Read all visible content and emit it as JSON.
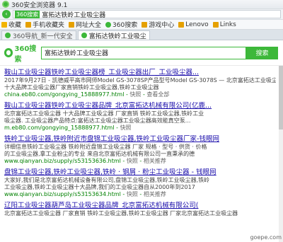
{
  "window": {
    "title": "360安全浏览器 9.1"
  },
  "address": {
    "engine_tag": "360搜索",
    "query": "富拓达铁岭工业吸尘器"
  },
  "bookmarks": [
    "收藏",
    "手机收藏夹",
    "网址大全",
    "360搜索",
    "游戏中心",
    "Lenovo",
    "Links"
  ],
  "tabs": [
    "360导航_新一代安全",
    "富拓达铁岭工业吸尘"
  ],
  "search": {
    "logo": "360搜索",
    "query": "富拓达铁岭工业吸尘器",
    "button": "搜索"
  },
  "results": [
    {
      "title": "鞍山工业吸尘器铁岭工业吸尘器榜_工业吸尘器出厂_工业吸尘器...",
      "desc1": "2017年9月27日 - 凯德威平高市网师Model GS-3078SP产品型号Model GS-3078S — 北京富拓达工业吸尘器",
      "desc2": "十大品牌工业吸尘器厂家直销铁岭工业吸尘器,铁岭工业吸尘器",
      "url": "china.eb80.com/gongying_15888977.html",
      "links": [
        "快照",
        "查看全部"
      ]
    },
    {
      "title": "鞍山工业吸尘器铁岭工业吸尘器品牌_北京富拓达机械有限公司(亿鹿...",
      "desc1": "北京富拓达工业吸尘器 十大品牌工业吸尘器 厂家直销 铁岭工业吸尘器,铁岭工业",
      "desc2": "吸尘器. 工业吸尘器产品特点:富拓达工业吸尘器工业吸尘器高效能真空泵...",
      "url": "m.eb80.com/gongying_15888977.html",
      "links": [
        "快照"
      ]
    },
    {
      "title": "铁岭工业吸尘器,铁岭附近市盘锦工业吸尘器,铁岭工业吸尘器厂家-钱眼网",
      "desc1": "详细信息铁岭工业吸尘器 铁岭附近盘锦工业吸尘器 厂家  规格 · 型号 · 供货 · 价格",
      "desc2": "的工业吸尘器,拿工业粉尘的专业 来自北京富拓达机械有限公司一直秉承的德",
      "url": "www.qianyan.biz/supply/s53153636.html",
      "links": [
        "快照",
        "相关推荐"
      ]
    },
    {
      "title": "盘锦工业吸尘器,铁岭工业吸尘器,铁岭 · 钢屑 · 粉尘工业吸尘器 - 钱眼网",
      "desc1": "大家好,我们是北京富拓达机械设备有限公司,盘锦工业吸尘器,铁岭工业吸尘器,铁岭",
      "desc2": "工业吸尘器,铁岭工业吸尘器十大品牌,我们的工业吸尘器自从2000年到2017",
      "url": "www.qianyan.biz/supply/s53153634.html",
      "links": [
        "快照",
        "相关推荐"
      ]
    },
    {
      "title": "辽阳工业吸尘器葫芦岛工业吸尘器品牌_北京富拓达机械有限公司(",
      "desc1": "北京富拓达工业吸尘器 厂家直销 铁岭工业吸尘器,铁岭工业吸尘器 厂家北京富拓达工业吸尘器",
      "desc2": "",
      "url": "",
      "links": []
    }
  ],
  "watermark": "goepe.com"
}
